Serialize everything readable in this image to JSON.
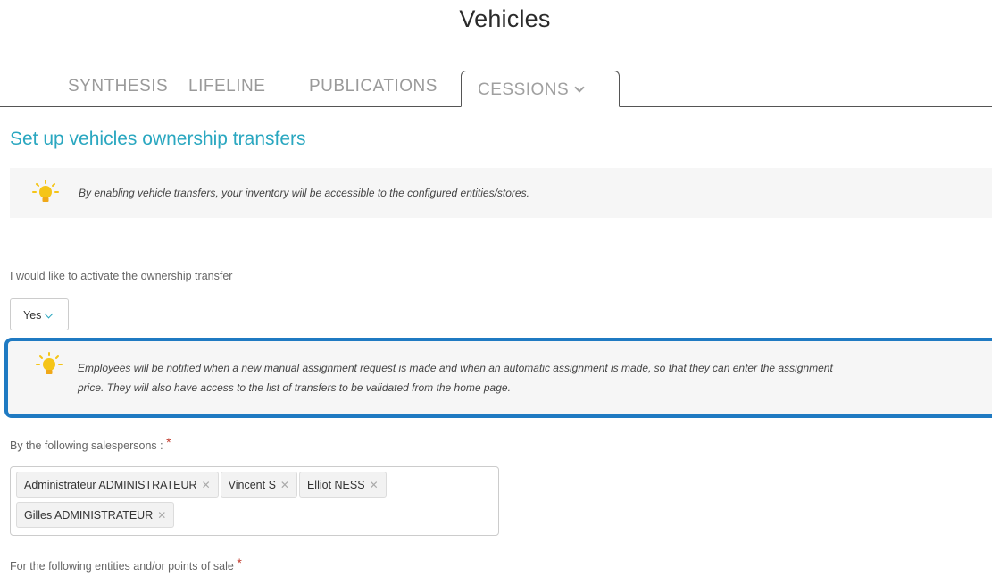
{
  "page": {
    "title": "Vehicles"
  },
  "tabs": [
    {
      "label": "SYNTHESIS"
    },
    {
      "label": "LIFELINE"
    },
    {
      "label": "PUBLICATIONS"
    },
    {
      "label": "CESSIONS",
      "active": true
    }
  ],
  "section": {
    "title": "Set up vehicles ownership transfers"
  },
  "info": {
    "text": "By enabling vehicle transfers, your inventory will be accessible to the configured entities/stores."
  },
  "activation": {
    "label": "I would like to activate the ownership transfer",
    "value": "Yes"
  },
  "notice": {
    "line1": "Employees will be notified when a new manual assignment request is made and when an automatic assignment is made, so that they can enter the assignment",
    "line2": "price. They will also have access to the list of transfers to be validated from the home page."
  },
  "salespersons": {
    "label": "By the following salespersons :",
    "required_mark": "*",
    "tags": [
      "Administrateur ADMINISTRATEUR",
      "Vincent S",
      "Elliot NESS",
      "Gilles ADMINISTRATEUR"
    ]
  },
  "entities": {
    "label": "For the following entities and/or points of sale",
    "required_mark": "*"
  },
  "colors": {
    "accent": "#2aa7c0",
    "notice_border": "#1f7ac2",
    "bulb": "#f5c518",
    "required": "#c0392b"
  }
}
